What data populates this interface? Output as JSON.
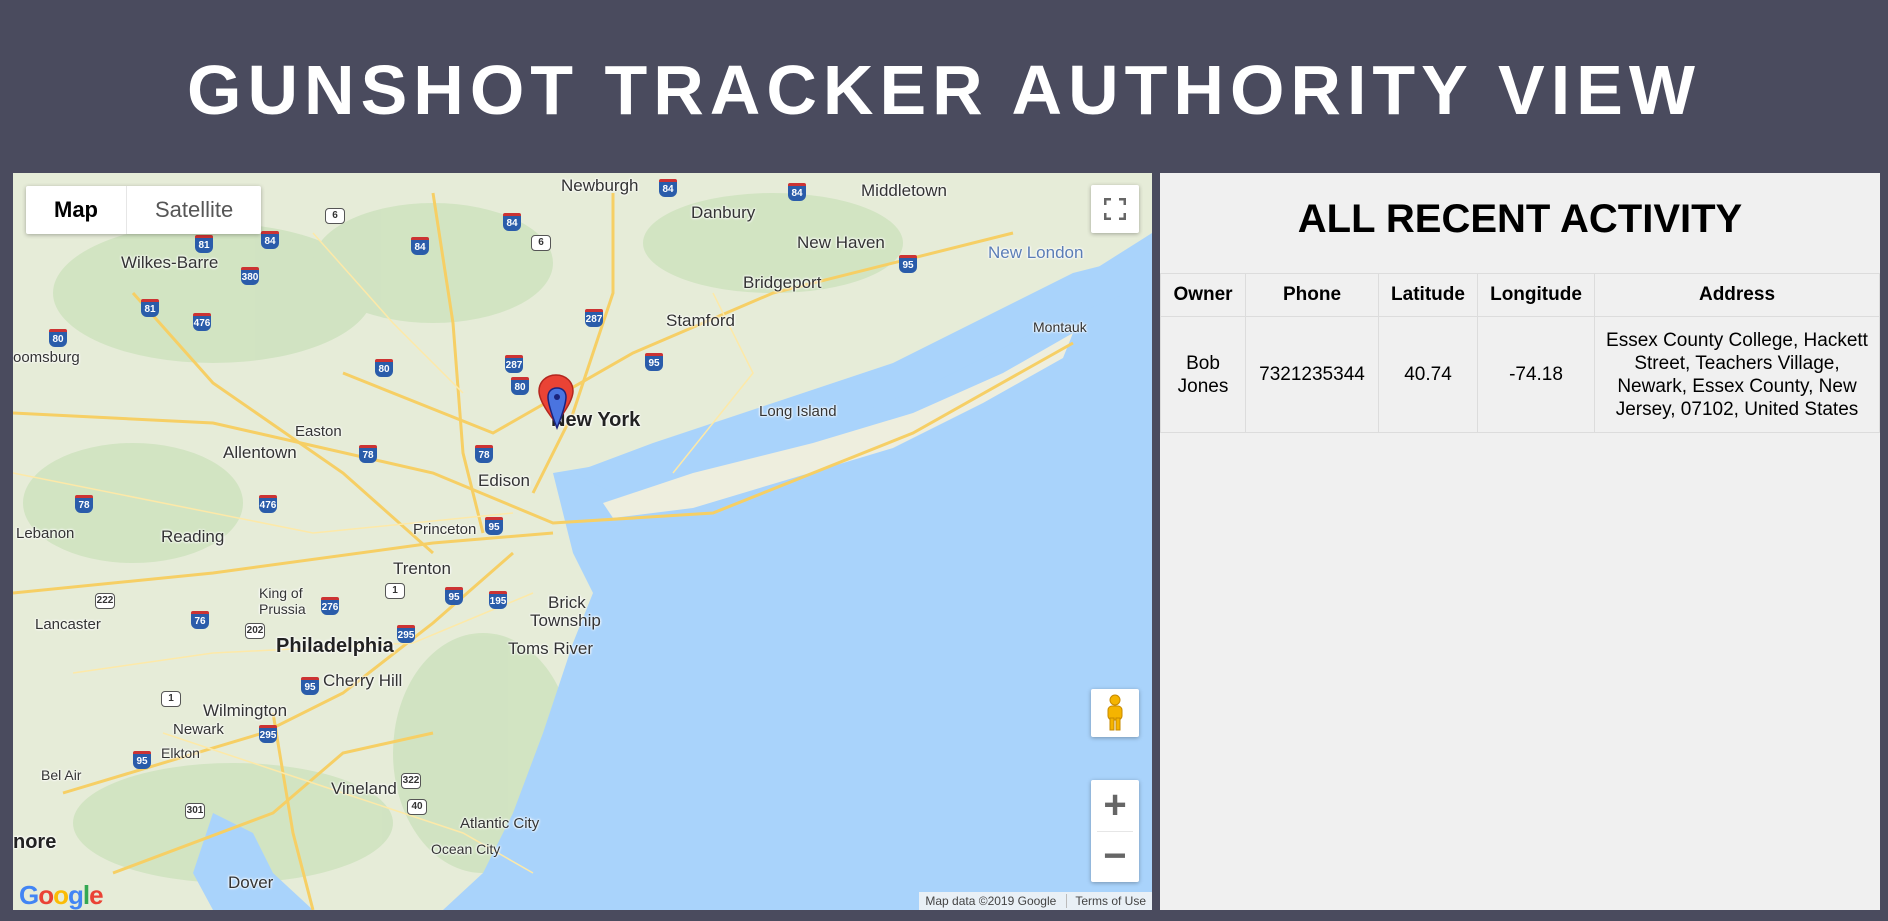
{
  "header": {
    "title": "GUNSHOT TRACKER AUTHORITY VIEW"
  },
  "map": {
    "type_buttons": [
      "Map",
      "Satellite"
    ],
    "fullscreen_icon": "fullscreen-icon",
    "pegman_icon": "pegman-icon",
    "zoom_in": "+",
    "zoom_out": "−",
    "logo": "Google",
    "attribution": "Map data ©2019 Google",
    "terms": "Terms of Use",
    "labels": {
      "newburgh": "Newburgh",
      "middletown": "Middletown",
      "danbury": "Danbury",
      "new_haven": "New Haven",
      "new_london": "New London",
      "wilkes_barre": "Wilkes-Barre",
      "bridgeport": "Bridgeport",
      "stamford": "Stamford",
      "montauk": "Montauk",
      "bloomsburg": "oomsburg",
      "new_york": "New York",
      "long_island": "Long Island",
      "easton": "Easton",
      "allentown": "Allentown",
      "edison": "Edison",
      "lebanon": "Lebanon",
      "reading": "Reading",
      "princeton": "Princeton",
      "trenton": "Trenton",
      "brick": "Brick",
      "township": "Township",
      "king_of": "King of",
      "prussia": "Prussia",
      "lancaster": "Lancaster",
      "philadelphia": "Philadelphia",
      "toms_river": "Toms River",
      "cherry_hill": "Cherry Hill",
      "wilmington": "Wilmington",
      "newark_de": "Newark",
      "elkton": "Elkton",
      "bel_air": "Bel Air",
      "vineland": "Vineland",
      "atlantic_city": "Atlantic City",
      "ocean_city": "Ocean City",
      "more": "nore",
      "dover": "Dover"
    }
  },
  "activity": {
    "title": "ALL RECENT ACTIVITY",
    "columns": [
      "Owner",
      "Phone",
      "Latitude",
      "Longitude",
      "Address"
    ],
    "rows": [
      {
        "owner": "Bob Jones",
        "phone": "7321235344",
        "latitude": "40.74",
        "longitude": "-74.18",
        "address": "Essex County College, Hackett Street, Teachers Village, Newark, Essex County, New Jersey, 07102, United States"
      }
    ]
  }
}
